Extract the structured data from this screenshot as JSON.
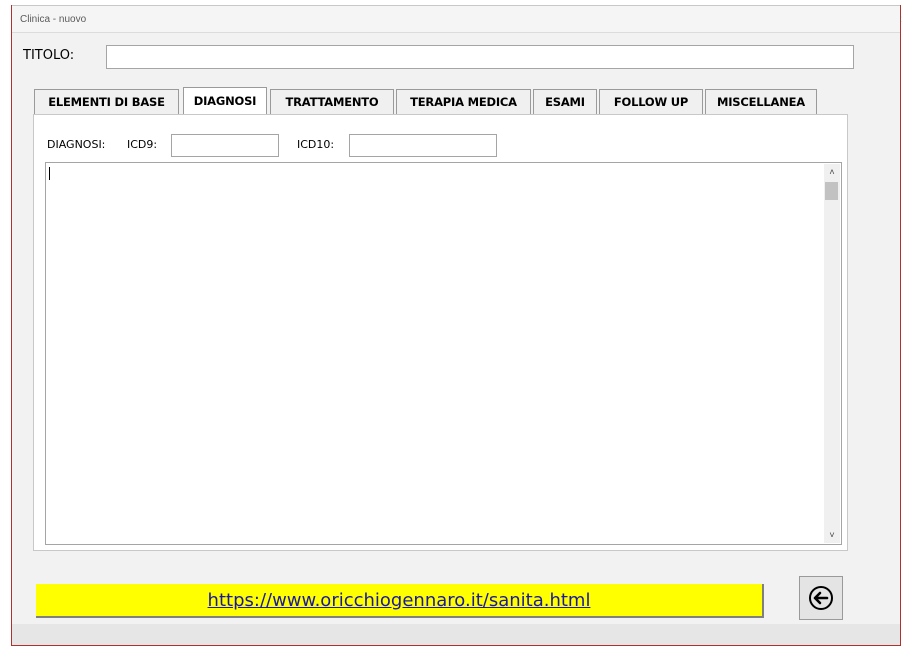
{
  "window": {
    "title": "Clinica - nuovo",
    "title_suffix": ":"
  },
  "titolo": {
    "label": "TITOLO:",
    "value": ""
  },
  "tabs": [
    {
      "label": "ELEMENTI DI BASE",
      "active": false
    },
    {
      "label": "DIAGNOSI",
      "active": true
    },
    {
      "label": "TRATTAMENTO",
      "active": false
    },
    {
      "label": "TERAPIA MEDICA",
      "active": false
    },
    {
      "label": "ESAMI",
      "active": false
    },
    {
      "label": "FOLLOW UP",
      "active": false
    },
    {
      "label": "MISCELLANEA",
      "active": false
    }
  ],
  "diagnosi": {
    "section_label": "DIAGNOSI:",
    "icd9_label": "ICD9:",
    "icd9_value": "",
    "icd10_label": "ICD10:",
    "icd10_value": "",
    "text_value": ""
  },
  "footer": {
    "link_text": "https://www.oricchiogennaro.it/sanita.html",
    "back_icon": "arrow-left-circle-icon"
  }
}
